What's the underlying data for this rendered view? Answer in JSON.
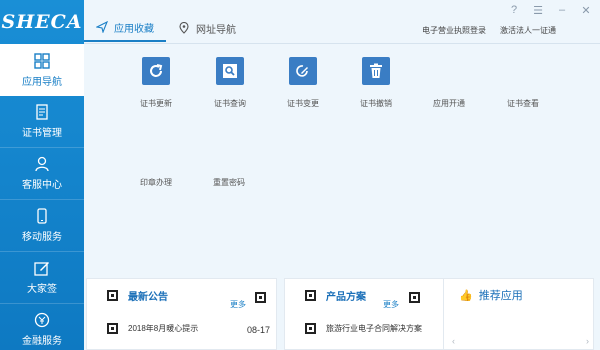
{
  "logo": "SHECA",
  "sidebar": {
    "items": [
      {
        "label": "应用导航",
        "icon": "grid-icon"
      },
      {
        "label": "证书管理",
        "icon": "document-icon"
      },
      {
        "label": "客服中心",
        "icon": "user-icon"
      },
      {
        "label": "移动服务",
        "icon": "phone-icon"
      },
      {
        "label": "大家签",
        "icon": "edit-icon"
      },
      {
        "label": "金融服务",
        "icon": "coin-icon"
      }
    ]
  },
  "tabs": [
    {
      "label": "应用收藏",
      "icon": "send-icon"
    },
    {
      "label": "网址导航",
      "icon": "location-icon"
    }
  ],
  "top_links": [
    "电子营业执照登录",
    "激活法人一证通"
  ],
  "apps": [
    {
      "label": "证书更新",
      "icon": "refresh-icon"
    },
    {
      "label": "证书查询",
      "icon": "search-icon"
    },
    {
      "label": "证书变更",
      "icon": "edit-circle-icon"
    },
    {
      "label": "证书撤销",
      "icon": "trash-icon"
    },
    {
      "label": "应用开通",
      "icon": ""
    },
    {
      "label": "证书查看",
      "icon": ""
    },
    {
      "label": "印章办理",
      "icon": ""
    },
    {
      "label": "重置密码",
      "icon": ""
    }
  ],
  "news": {
    "title": "最新公告",
    "more": "更多",
    "items": [
      {
        "text": "2018年8月暖心提示",
        "date": "08-17"
      }
    ]
  },
  "products": {
    "title": "产品方案",
    "more": "更多",
    "items": [
      {
        "text": "旅游行业电子合同解决方案"
      }
    ]
  },
  "recommend": {
    "title": "推荐应用"
  },
  "colors": {
    "sidebar": "#1a8fd6",
    "accent": "#1a7fc6",
    "tile": "#3a7dc4"
  }
}
